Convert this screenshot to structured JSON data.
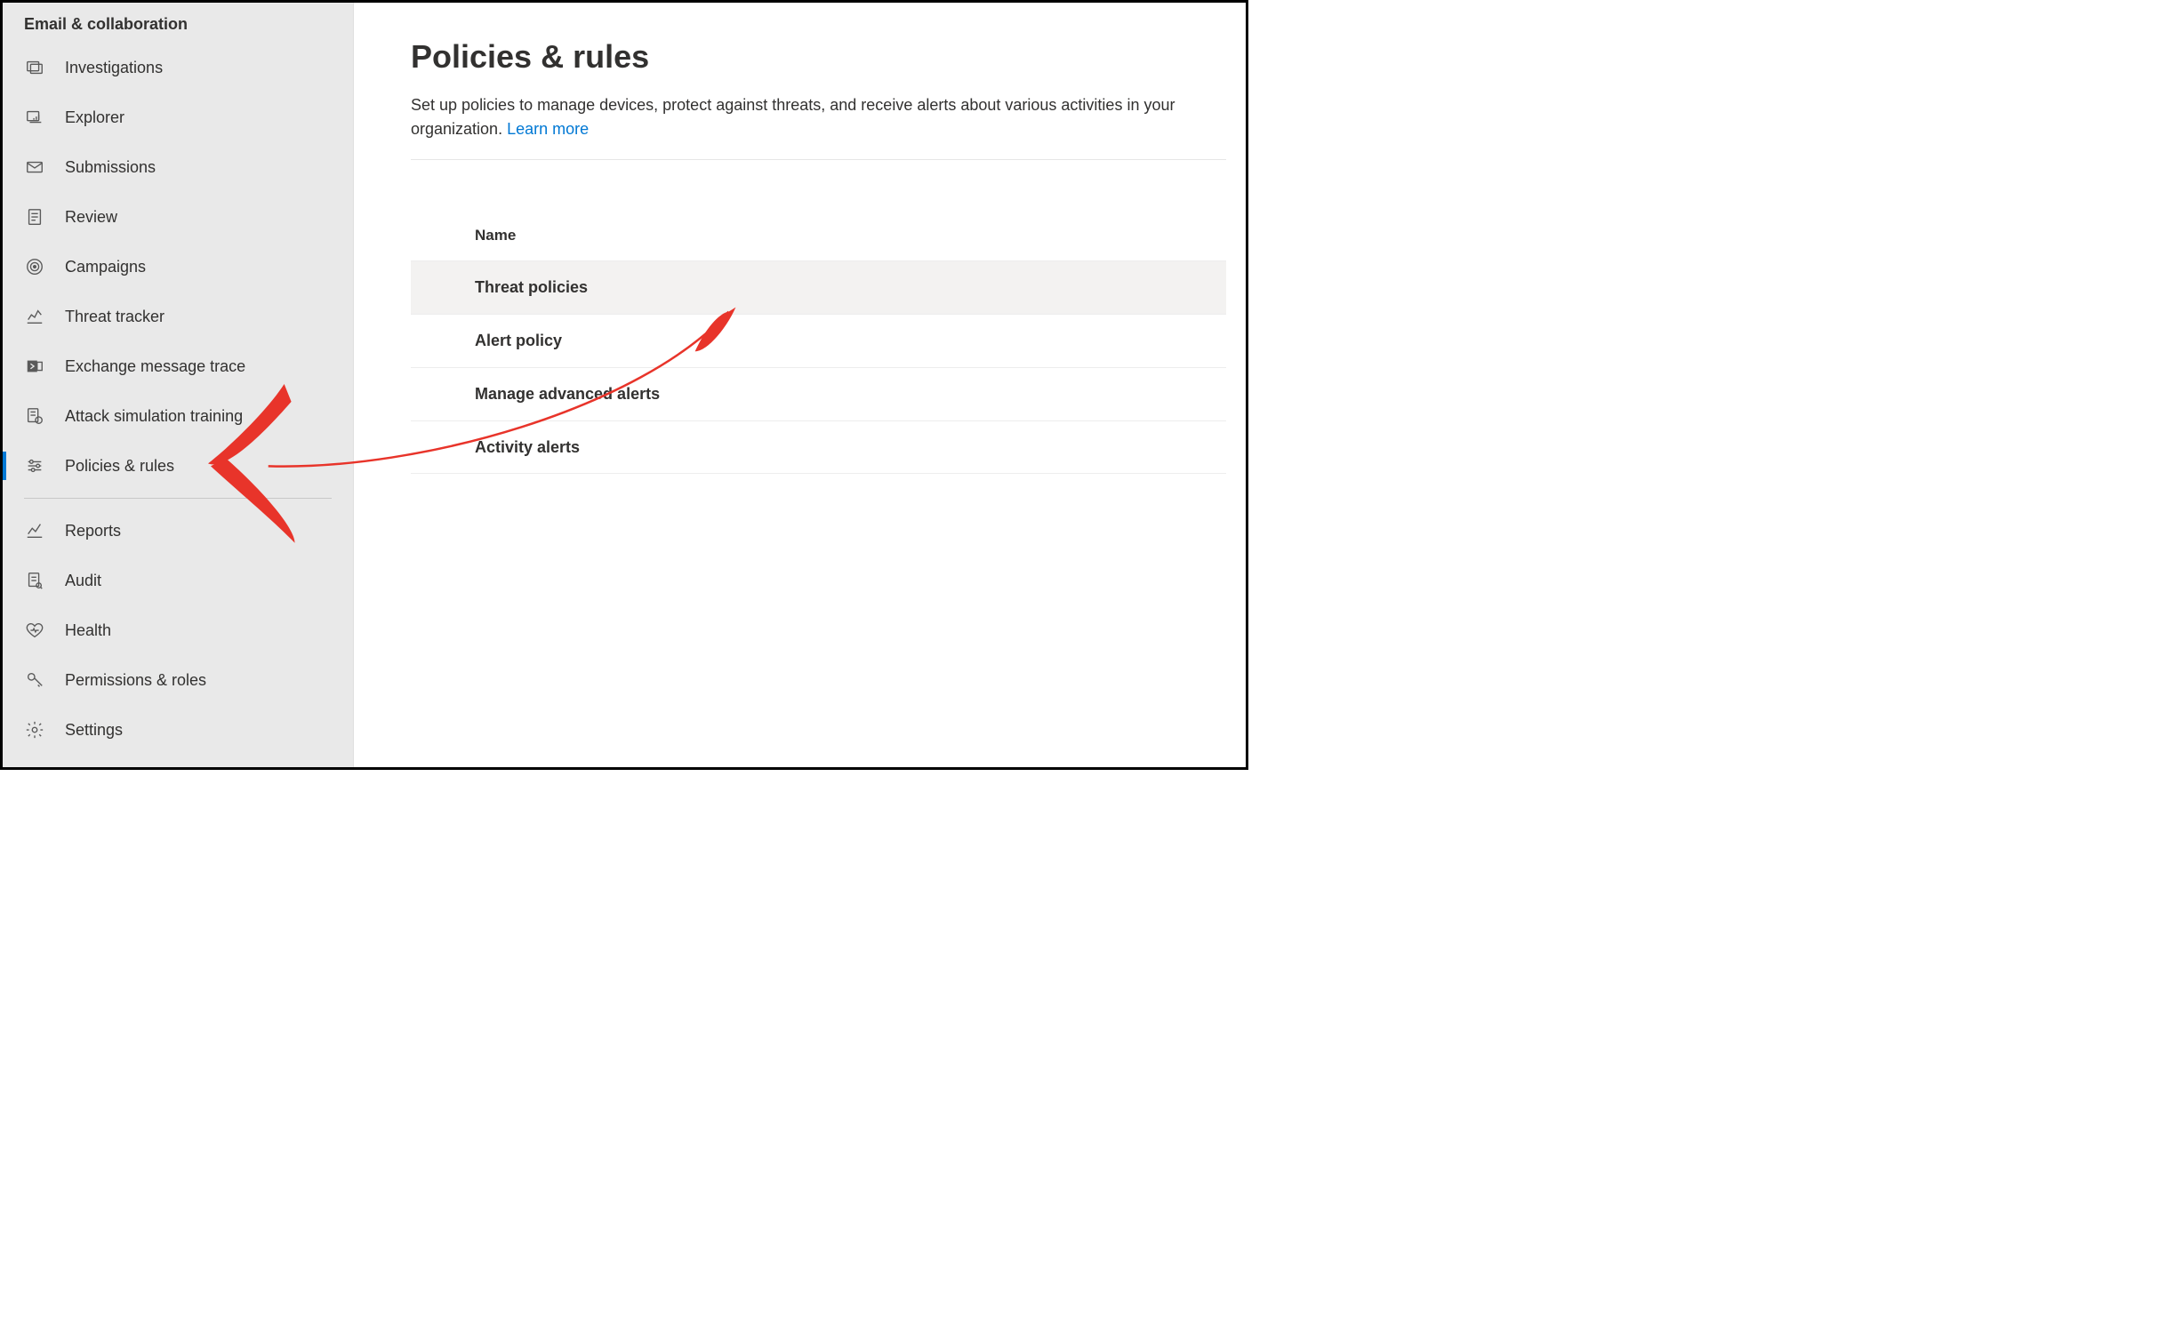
{
  "sidebar": {
    "section_title": "Email & collaboration",
    "items": [
      {
        "label": "Investigations"
      },
      {
        "label": "Explorer"
      },
      {
        "label": "Submissions"
      },
      {
        "label": "Review"
      },
      {
        "label": "Campaigns"
      },
      {
        "label": "Threat tracker"
      },
      {
        "label": "Exchange message trace"
      },
      {
        "label": "Attack simulation training"
      },
      {
        "label": "Policies & rules"
      }
    ],
    "below": [
      {
        "label": "Reports"
      },
      {
        "label": "Audit"
      },
      {
        "label": "Health"
      },
      {
        "label": "Permissions & roles"
      },
      {
        "label": "Settings"
      }
    ]
  },
  "main": {
    "title": "Policies & rules",
    "description": "Set up policies to manage devices, protect against threats, and receive alerts about various activities in your organization. ",
    "learn_more": "Learn more",
    "column_header": "Name",
    "rows": [
      "Threat policies",
      "Alert policy",
      "Manage advanced alerts",
      "Activity alerts"
    ]
  }
}
